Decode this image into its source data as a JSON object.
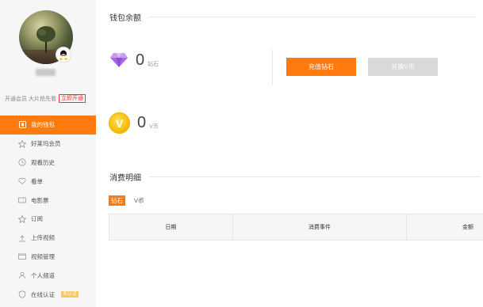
{
  "sidebar": {
    "promo_text": "开通会员 大片抢先看",
    "promo_button": "立即开通",
    "items": [
      {
        "label": "我的钱包",
        "icon": "wallet-icon"
      },
      {
        "label": "好莱坞会员",
        "icon": "star-icon"
      },
      {
        "label": "观看历史",
        "icon": "history-icon"
      },
      {
        "label": "看单",
        "icon": "heart-icon"
      },
      {
        "label": "电影票",
        "icon": "ticket-icon"
      },
      {
        "label": "订阅",
        "icon": "star-outline-icon"
      },
      {
        "label": "上传视频",
        "icon": "upload-icon"
      },
      {
        "label": "视频管理",
        "icon": "folder-icon"
      },
      {
        "label": "个人频道",
        "icon": "user-icon"
      },
      {
        "label": "在线认证",
        "icon": "certify-icon",
        "tag": "未认证"
      }
    ]
  },
  "wallet": {
    "title": "钱包余额",
    "diamond_amount": "0",
    "diamond_unit": "钻石",
    "recharge_button": "充值钻石",
    "exchange_button": "兑换V币",
    "vcoin_amount": "0",
    "vcoin_unit": "V币",
    "vcoin_glyph": "V"
  },
  "consumption": {
    "title": "消费明细",
    "tabs": [
      "钻石",
      "V币"
    ],
    "columns": [
      "日期",
      "消费事件",
      "金额"
    ]
  },
  "colors": {
    "accent": "#ff7a0f",
    "disabled": "#d9d9d9",
    "diamond": "#9b59d6",
    "coin": "#f4b400"
  }
}
